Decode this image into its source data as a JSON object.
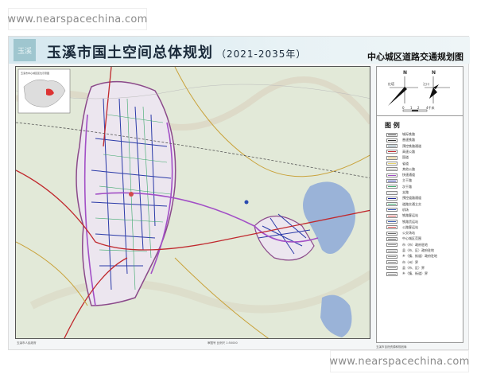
{
  "watermark": {
    "top_left": "www.nearspacechina.com",
    "bottom_right": "www.nearspacechina.com"
  },
  "header": {
    "logo_text": "玉溪",
    "title": "玉溪市国土空间总体规划",
    "years": "（2021-2035年）",
    "subtitle": "中心城区道路交通规划图"
  },
  "compass": {
    "north_label": "N",
    "left_label": "红塔",
    "right_label": "江川",
    "scale_labels": [
      "0",
      "1",
      "2",
      "4千米"
    ]
  },
  "legend": {
    "title": "图 例",
    "items": [
      {
        "label": "城际铁路",
        "color": "#333"
      },
      {
        "label": "普速铁路",
        "color": "#333"
      },
      {
        "label": "预控铁路通道",
        "color": "#5a7a8a"
      },
      {
        "label": "高速公路",
        "color": "#c0282d"
      },
      {
        "label": "国道",
        "color": "#c9a23a"
      },
      {
        "label": "省道",
        "color": "#e6d36a"
      },
      {
        "label": "其他公路",
        "color": "#aaa"
      },
      {
        "label": "快速通道",
        "color": "#a24fc6"
      },
      {
        "label": "主干路",
        "color": "#1f2a9a"
      },
      {
        "label": "次干路",
        "color": "#3aa86a"
      },
      {
        "label": "支路",
        "color": "#ccc"
      },
      {
        "label": "预控道路通道",
        "color": "#1f2a9a"
      },
      {
        "label": "道路交通立交",
        "color": "#3aa86a"
      },
      {
        "label": "机场",
        "color": "#2a4ab0"
      },
      {
        "label": "铁路客运站",
        "color": "#d24a4a"
      },
      {
        "label": "铁路货运站",
        "color": "#3a5ab0"
      },
      {
        "label": "公路客运站",
        "color": "#d24a4a"
      },
      {
        "label": "公交场站",
        "color": "#666"
      },
      {
        "label": "中心城区范围",
        "color": "#555"
      },
      {
        "label": "市（市）政府驻地",
        "color": "#888"
      },
      {
        "label": "县（市、区）政府驻地",
        "color": "#888"
      },
      {
        "label": "乡（镇、街道）政府驻地",
        "color": "#888"
      },
      {
        "label": "市（州）界",
        "color": "#888"
      },
      {
        "label": "县（市、区）界",
        "color": "#888"
      },
      {
        "label": "乡（镇、街道）界",
        "color": "#888"
      }
    ]
  },
  "map": {
    "inset_title": "玉溪市中心城区区位示意图"
  },
  "footer": {
    "left": "玉溪市人民政府",
    "middle": "审图号 比例尺 1:50000",
    "right": "玉溪市自然资源和规划局"
  }
}
